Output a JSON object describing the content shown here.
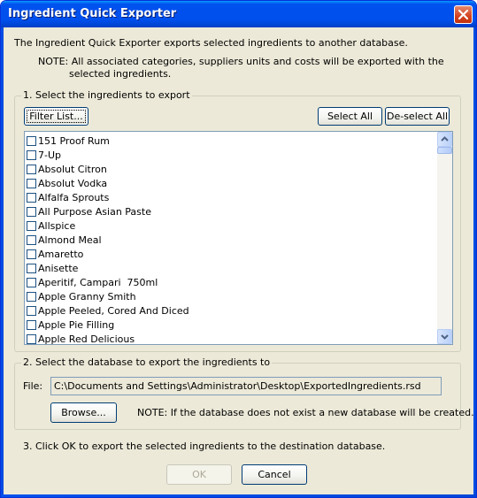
{
  "window": {
    "title": "Ingredient Quick Exporter"
  },
  "intro": {
    "text": "The Ingredient Quick Exporter exports selected ingredients to another database.",
    "note_line1": "NOTE: All associated categories, suppliers units and costs will be exported with the",
    "note_line2": "selected ingredients."
  },
  "step1": {
    "label": "1. Select the ingredients to export",
    "filter_button": "Filter List...",
    "select_all_button": "Select All",
    "deselect_all_button": "De-select All",
    "ingredients": [
      "151 Proof Rum",
      "7-Up",
      "Absolut Citron",
      "Absolut Vodka",
      "Alfalfa Sprouts",
      "All Purpose Asian Paste",
      "Allspice",
      "Almond Meal",
      "Amaretto",
      "Anisette",
      "Aperitif, Campari  750ml",
      "Apple Granny Smith",
      "Apple Peeled, Cored And Diced",
      "Apple Pie Filling",
      "Apple Red Delicious"
    ]
  },
  "step2": {
    "label": "2. Select the database to export the ingredients to",
    "file_label": "File:",
    "file_path": "C:\\Documents and Settings\\Administrator\\Desktop\\ExportedIngredients.rsd",
    "browse_button": "Browse...",
    "note": "NOTE: If the database does not exist a new database will be created."
  },
  "step3": {
    "text": "3. Click OK to export the selected ingredients to the destination database."
  },
  "footer": {
    "ok_button": "OK",
    "cancel_button": "Cancel"
  }
}
